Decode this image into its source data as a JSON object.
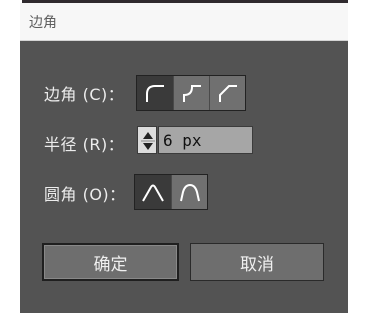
{
  "dialog": {
    "title": "边角"
  },
  "corner": {
    "label": "边角 (C)：",
    "options": [
      {
        "icon": "round-corner-icon",
        "selected": true
      },
      {
        "icon": "inverted-round-corner-icon",
        "selected": false
      },
      {
        "icon": "chamfer-corner-icon",
        "selected": false
      }
    ]
  },
  "radius": {
    "label": "半径 (R)：",
    "value": "6 px"
  },
  "rounding": {
    "label": "圆角 (O)：",
    "options": [
      {
        "icon": "relative-rounding-icon",
        "selected": true
      },
      {
        "icon": "absolute-rounding-icon",
        "selected": false
      }
    ]
  },
  "buttons": {
    "ok": "确定",
    "cancel": "取消"
  },
  "colors": {
    "dialog_bg": "#535353",
    "selected_bg": "#3a3a3a",
    "unselected_bg": "#707070"
  }
}
